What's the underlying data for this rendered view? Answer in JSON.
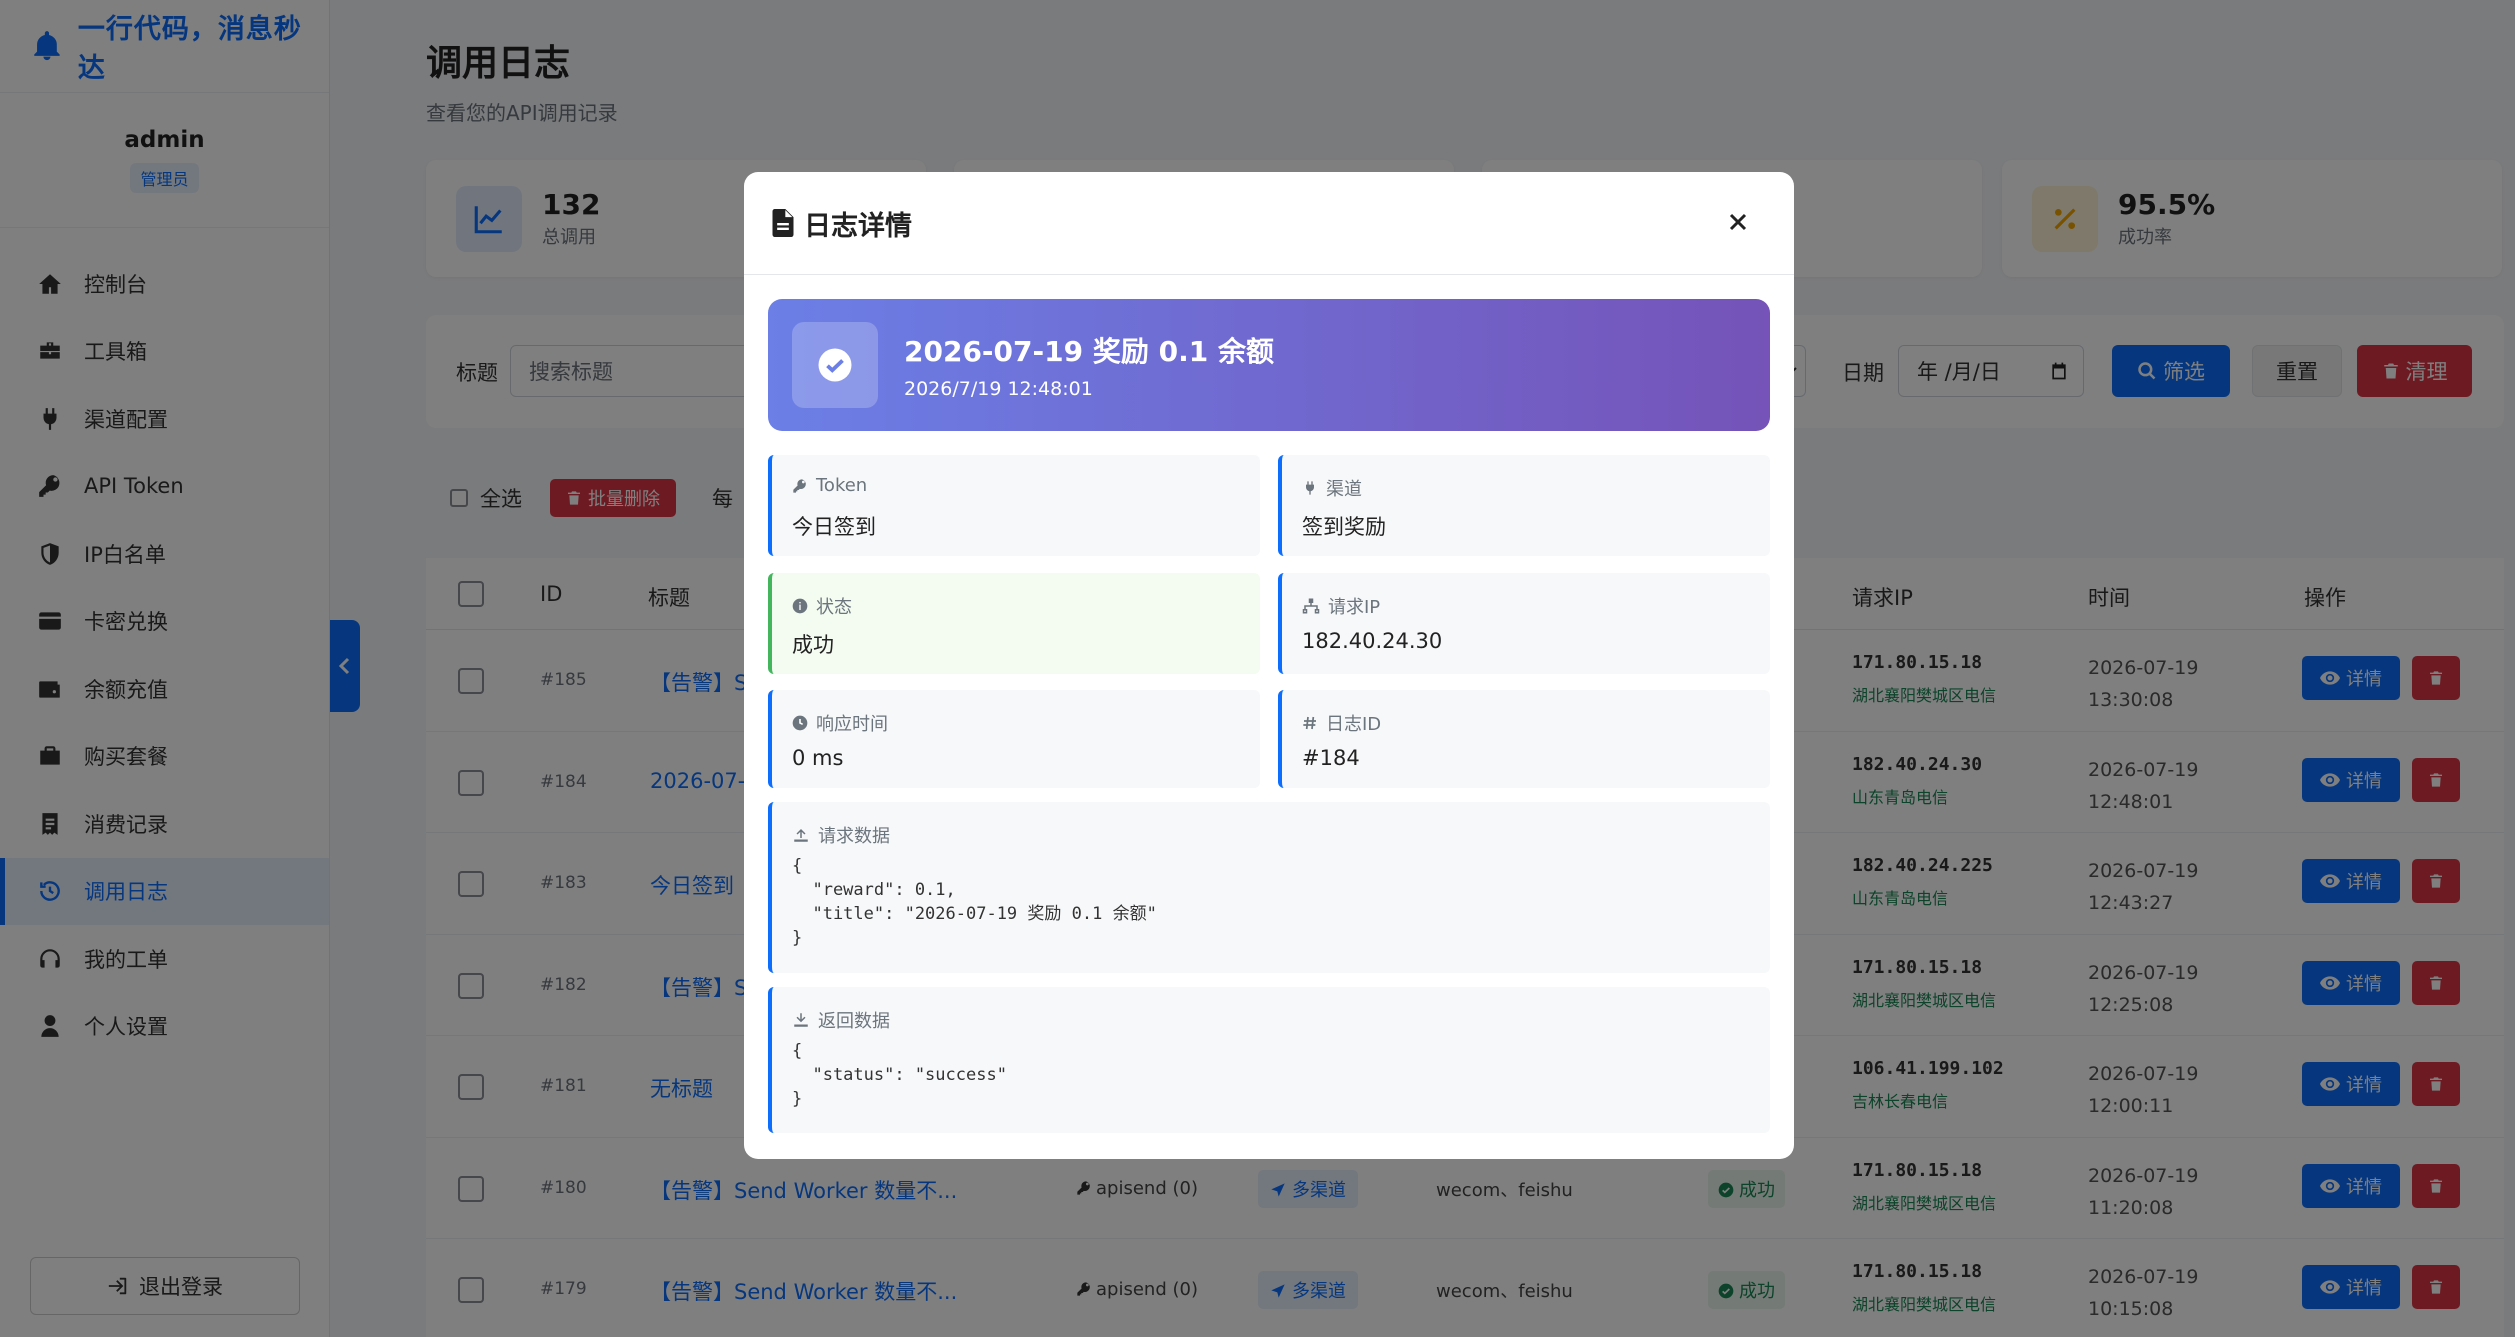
{
  "brand": {
    "text": "一行代码，消息秒达"
  },
  "user": {
    "name": "admin",
    "role": "管理员"
  },
  "nav": [
    {
      "label": "控制台",
      "icon": "home-icon"
    },
    {
      "label": "工具箱",
      "icon": "toolbox-icon"
    },
    {
      "label": "渠道配置",
      "icon": "plug-icon"
    },
    {
      "label": "API Token",
      "icon": "key-icon"
    },
    {
      "label": "IP白名单",
      "icon": "shield-icon"
    },
    {
      "label": "卡密兑换",
      "icon": "card-icon"
    },
    {
      "label": "余额充值",
      "icon": "wallet-icon"
    },
    {
      "label": "购买套餐",
      "icon": "briefcase-icon"
    },
    {
      "label": "消费记录",
      "icon": "receipt-icon"
    },
    {
      "label": "调用日志",
      "icon": "history-icon",
      "active": true
    },
    {
      "label": "我的工单",
      "icon": "headset-icon"
    },
    {
      "label": "个人设置",
      "icon": "user-icon"
    }
  ],
  "logout": "退出登录",
  "page": {
    "title": "调用日志",
    "subtitle": "查看您的API调用记录"
  },
  "stats": [
    {
      "value": "132",
      "label": "总调用",
      "icon": "chart-line-icon"
    },
    {
      "value": "95.5%",
      "label": "成功率",
      "icon": "percent-icon"
    }
  ],
  "filters": {
    "title_label": "标题",
    "title_placeholder": "搜索标题",
    "date_label": "日期",
    "date_placeholder": "年 /月/日",
    "filter_btn": "筛选",
    "reset_btn": "重置",
    "clear_btn": "清理"
  },
  "bulk": {
    "select_all": "全选",
    "bulk_delete": "批量删除",
    "per_page_partial": "每"
  },
  "table": {
    "headers": {
      "id": "ID",
      "title": "标题",
      "ip": "请求IP",
      "time": "时间",
      "actions": "操作"
    },
    "detail_btn": "详情",
    "rows": [
      {
        "id": "#185",
        "title": "【告警】S",
        "ip": "171.80.15.18",
        "loc": "湖北襄阳樊城区电信",
        "date": "2026-07-19",
        "time": "13:30:08"
      },
      {
        "id": "#184",
        "title": "2026-07-1",
        "ip": "182.40.24.30",
        "loc": "山东青岛电信",
        "date": "2026-07-19",
        "time": "12:48:01"
      },
      {
        "id": "#183",
        "title": "今日签到",
        "ip": "182.40.24.225",
        "loc": "山东青岛电信",
        "date": "2026-07-19",
        "time": "12:43:27"
      },
      {
        "id": "#182",
        "title": "【告警】S",
        "ip": "171.80.15.18",
        "loc": "湖北襄阳樊城区电信",
        "date": "2026-07-19",
        "time": "12:25:08"
      },
      {
        "id": "#181",
        "title": "无标题",
        "ip": "106.41.199.102",
        "loc": "吉林长春电信",
        "date": "2026-07-19",
        "time": "12:00:11"
      },
      {
        "id": "#180",
        "title": "【告警】Send Worker 数量不...",
        "token": "apisend (0)",
        "channel": "多渠道",
        "targets": "wecom、feishu",
        "status": "成功",
        "ip": "171.80.15.18",
        "loc": "湖北襄阳樊城区电信",
        "date": "2026-07-19",
        "time": "11:20:08"
      },
      {
        "id": "#179",
        "title": "【告警】Send Worker 数量不...",
        "token": "apisend (0)",
        "channel": "多渠道",
        "targets": "wecom、feishu",
        "status": "成功",
        "ip": "171.80.15.18",
        "loc": "湖北襄阳樊城区电信",
        "date": "2026-07-19",
        "time": "10:15:08"
      }
    ]
  },
  "modal": {
    "title": "日志详情",
    "hero_title": "2026-07-19 奖励 0.1 余额",
    "hero_time": "2026/7/19 12:48:01",
    "fields": {
      "token": {
        "label": "Token",
        "value": "今日签到"
      },
      "channel": {
        "label": "渠道",
        "value": "签到奖励"
      },
      "status": {
        "label": "状态",
        "value": "成功"
      },
      "ip": {
        "label": "请求IP",
        "value": "182.40.24.30"
      },
      "latency": {
        "label": "响应时间",
        "value": "0 ms"
      },
      "log_id": {
        "label": "日志ID",
        "value": "#184"
      }
    },
    "request": {
      "label": "请求数据",
      "body": "{\n  \"reward\": 0.1,\n  \"title\": \"2026-07-19 奖励 0.1 余额\"\n}"
    },
    "response": {
      "label": "返回数据",
      "body": "{\n  \"status\": \"success\"\n}"
    }
  },
  "colors": {
    "primary": "#0d6efd",
    "danger": "#dc3545",
    "success": "#198754",
    "hero_start": "#6b7fe6",
    "hero_end": "#7553b8"
  }
}
